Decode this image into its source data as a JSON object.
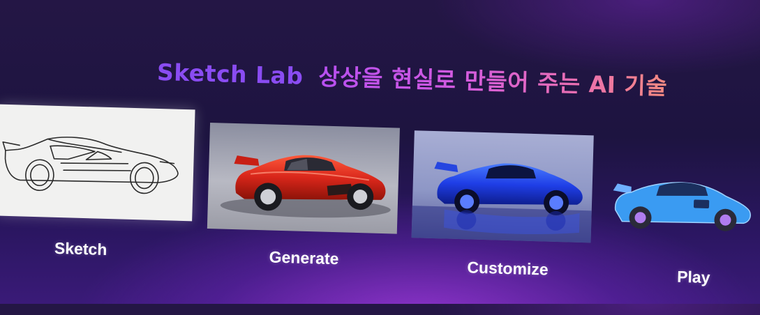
{
  "headline": {
    "brand": "Sketch Lab",
    "tagline": "상상을 현실로 만들어 주는 AI 기술"
  },
  "steps": [
    {
      "label": "Sketch",
      "image": "car-line-sketch"
    },
    {
      "label": "Generate",
      "image": "red-race-car-render"
    },
    {
      "label": "Customize",
      "image": "blue-race-car-render"
    },
    {
      "label": "Play",
      "image": "blue-cartoon-race-car"
    }
  ],
  "colors": {
    "background": "#1d1440",
    "brand_text": "#8a4cf2",
    "tagline_gradient": [
      "#b64ff0",
      "#ea6fb0",
      "#f48a80"
    ],
    "label_text": "#ffffff"
  }
}
